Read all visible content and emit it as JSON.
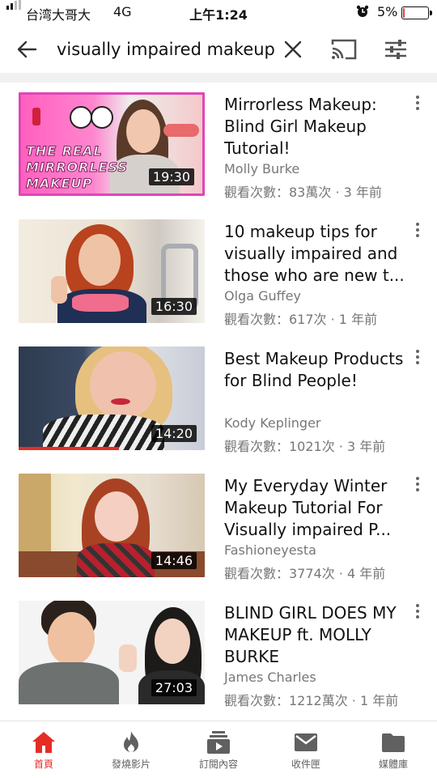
{
  "status_bar": {
    "carrier": "台湾大哥大",
    "network": "4G",
    "time": "上午1:24",
    "battery": "5%",
    "battery_level": 0.05,
    "battery_color": "#e53935"
  },
  "search": {
    "query": "visually impaired makeup",
    "icons": [
      "back-arrow-icon",
      "clear-icon",
      "cast-icon",
      "filter-icon"
    ]
  },
  "results": [
    {
      "title": "Mirrorless Makeup: Blind Girl Makeup Tutorial!",
      "channel": "Molly Burke",
      "meta": "觀看次數：83萬次 · 3 年前",
      "duration": "19:30",
      "thumb_text": [
        "THE REAL",
        "MIRRORLESS",
        "MAKEUP"
      ],
      "watched_fraction": 0
    },
    {
      "title": "10 makeup tips for visually impaired and those who are new t...",
      "channel": "Olga Guffey",
      "meta": "觀看次數：617次 · 1 年前",
      "duration": "16:30",
      "watched_fraction": 0
    },
    {
      "title": "Best Makeup Products for Blind People!",
      "channel": "Kody Keplinger",
      "meta": "觀看次數：1021次 · 3 年前",
      "duration": "14:20",
      "watched_fraction": 0.54
    },
    {
      "title": "My Everyday Winter Makeup Tutorial For Visually impaired P...",
      "channel": "Fashioneyesta",
      "meta": "觀看次數：3774次 · 4 年前",
      "duration": "14:46",
      "watched_fraction": 0
    },
    {
      "title": "BLIND GIRL DOES MY MAKEUP ft. MOLLY BURKE",
      "channel": "James Charles",
      "meta": "觀看次數：1212萬次 · 1 年前",
      "duration": "27:03",
      "watched_fraction": 0
    }
  ],
  "nav": {
    "items": [
      {
        "label": "首頁",
        "icon": "home-icon",
        "active": true
      },
      {
        "label": "發燒影片",
        "icon": "flame-icon",
        "active": false
      },
      {
        "label": "訂閱內容",
        "icon": "subscriptions-icon",
        "active": false
      },
      {
        "label": "收件匣",
        "icon": "inbox-icon",
        "active": false
      },
      {
        "label": "媒體庫",
        "icon": "library-icon",
        "active": false
      }
    ],
    "active_color": "#e52d27"
  }
}
